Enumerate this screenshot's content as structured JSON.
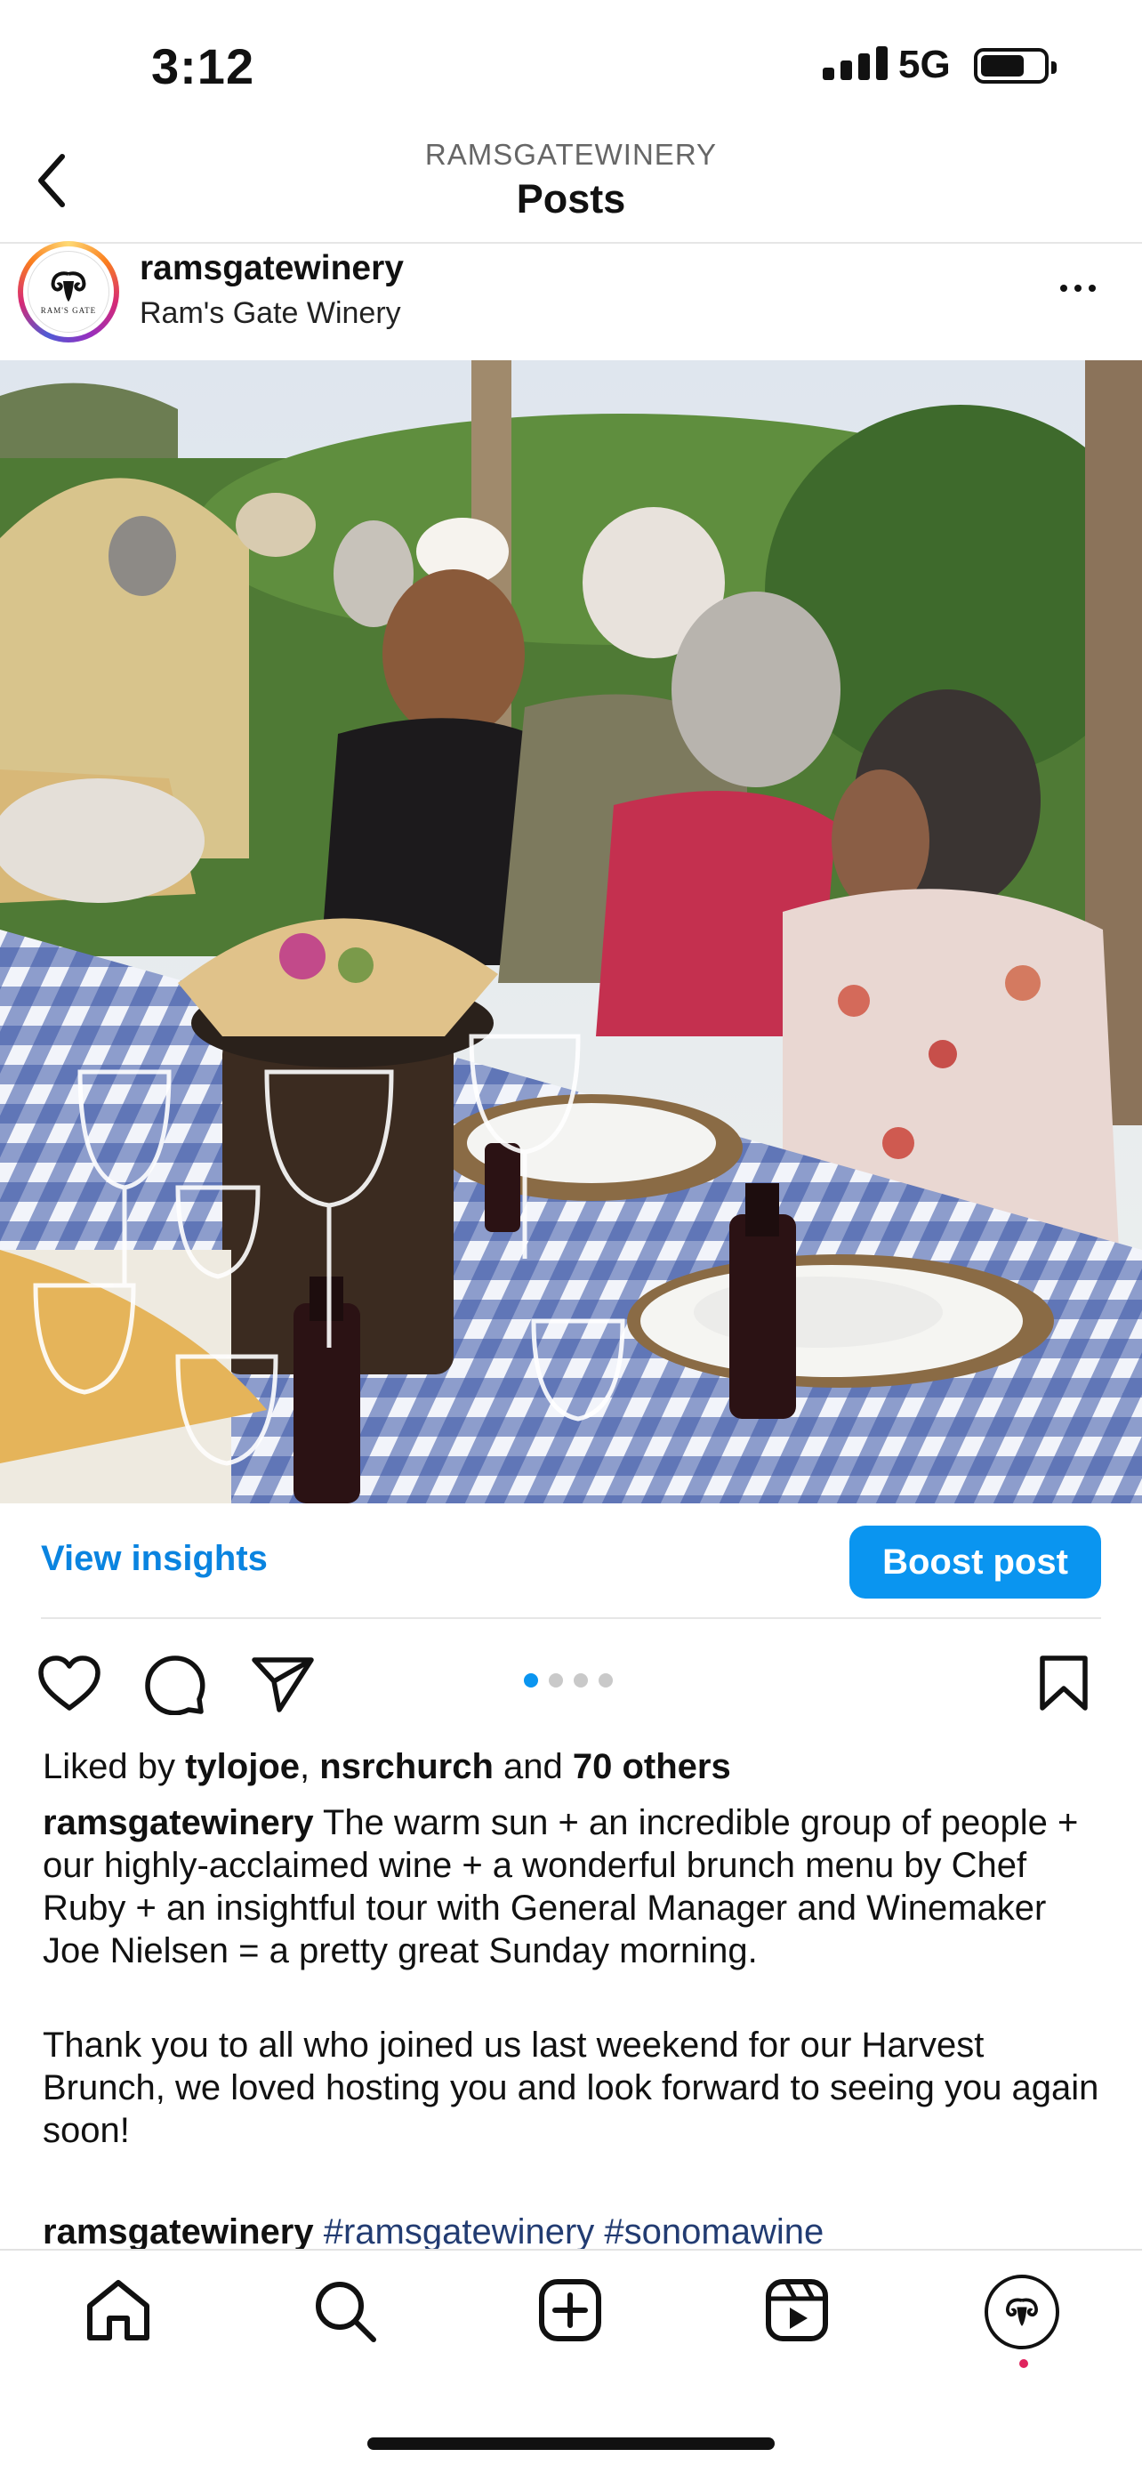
{
  "status_bar": {
    "time": "3:12",
    "network": "5G",
    "battery_level": 0.7
  },
  "header": {
    "account_name": "RAMSGATEWINERY",
    "title": "Posts"
  },
  "post": {
    "username": "ramsgatewinery",
    "location": "Ram's Gate Winery",
    "avatar_text": "RAM'S GATE",
    "carousel": {
      "count": 4,
      "active_index": 0
    },
    "view_insights_label": "View insights",
    "boost_label": "Boost post",
    "likes": {
      "prefix": "Liked by",
      "user1": "tylojoe",
      "separator": ",",
      "user2": "nsrchurch",
      "conjunction": "and",
      "others": "70 others"
    },
    "caption": {
      "username": "ramsgatewinery",
      "paragraph1": "The warm sun + an incredible group of people + our highly-acclaimed wine + a wonderful brunch menu by Chef Ruby + an insightful tour with General Manager and Winemaker Joe Nielsen = a pretty great Sunday morning.",
      "paragraph2": "Thank you to all who joined us last weekend for our Harvest Brunch, we loved hosting you and look forward to seeing you again soon!",
      "tag_username": "ramsgatewinery",
      "hashtags": [
        "#ramsgatewinery",
        "#sonomawine"
      ]
    }
  },
  "icons": {
    "back": "chevron-left-icon",
    "more": "more-icon",
    "like": "heart-icon",
    "comment": "comment-icon",
    "share": "send-icon",
    "save": "bookmark-icon",
    "nav": [
      "home-icon",
      "search-icon",
      "add-icon",
      "reels-icon",
      "profile-icon"
    ]
  },
  "colors": {
    "accent": "#0a95f0",
    "link": "#0a84e0",
    "hashtag": "#223c72",
    "notification": "#e0245e"
  }
}
